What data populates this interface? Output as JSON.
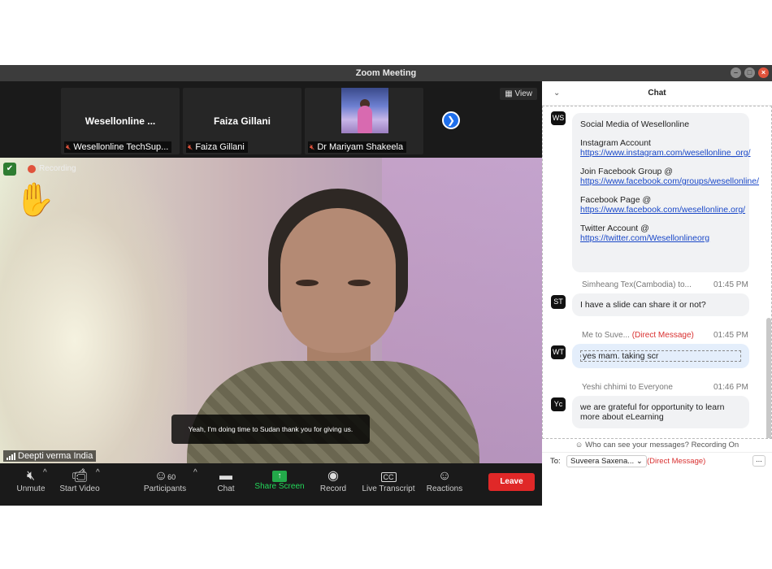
{
  "window": {
    "title": "Zoom Meeting"
  },
  "gallery": {
    "view_label": "View",
    "tiles": [
      {
        "display_name": "Wesellonline ...",
        "label": "Wesellonline TechSup..."
      },
      {
        "display_name": "Faiza Gillani",
        "label": "Faiza Gillani"
      },
      {
        "display_name": "",
        "label": "Dr Mariyam Shakeela"
      }
    ],
    "next_icon": "chevron-right-icon"
  },
  "main_video": {
    "recording_label": "Recording",
    "caption": "Yeah, I'm doing time to Sudan thank you for giving us.",
    "speaker_name": "Deepti verma India",
    "reaction_icon": "raised-hand-icon"
  },
  "toolbar": {
    "unmute": "Unmute",
    "start_video": "Start Video",
    "participants": "Participants",
    "participants_count": "60",
    "chat": "Chat",
    "share_screen": "Share Screen",
    "record": "Record",
    "live_transcript": "Live Transcript",
    "reactions": "Reactions",
    "leave": "Leave"
  },
  "chat": {
    "header": "Chat",
    "messages": [
      {
        "avatar": "WS",
        "lines": {
          "social": "Social Media of Wesellonline",
          "insta_label": "Instagram Account",
          "insta_link": "https://www.instagram.com/wesellonline_org/",
          "fbgroup_label": "Join Facebook Group @",
          "fbgroup_link": "https://www.facebook.com/groups/wesellonline/",
          "fbpage_label": "Facebook Page @",
          "fbpage_link": "https://www.facebook.com/wesellonline.org/",
          "twitter_label": "Twitter Account @",
          "twitter_link": "https://twitter.com/Wesellonlineorg"
        }
      },
      {
        "avatar": "ST",
        "sender": "Simheang Tex(Cambodia) to...",
        "time": "01:45 PM",
        "text": "I have a slide can share it or not?"
      },
      {
        "avatar": "WT",
        "sender": "Me to Suve...",
        "direct": "(Direct Message)",
        "time": "01:45 PM",
        "text": "yes mam. taking scr"
      },
      {
        "avatar": "Yc",
        "sender": "Yeshi chhimi to Everyone",
        "time": "01:46 PM",
        "text": "we are grateful for opportunity to learn more about eLearning"
      }
    ],
    "privacy_note": "Who can see your messages? Recording On",
    "to_label": "To:",
    "recipient": "Suveera Saxena...",
    "direct_label": "(Direct Message)",
    "more_label": "..."
  }
}
